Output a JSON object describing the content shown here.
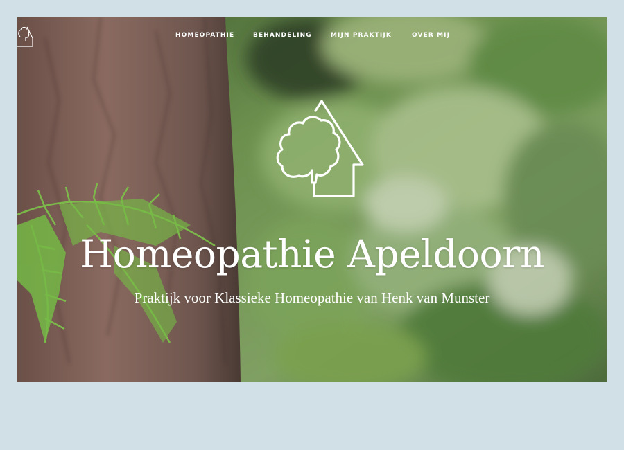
{
  "nav": {
    "items": [
      {
        "label": "HOMEOPATHIE"
      },
      {
        "label": "BEHANDELING"
      },
      {
        "label": "MIJN PRAKTIJK"
      },
      {
        "label": "OVER MIJ"
      }
    ]
  },
  "hero": {
    "title": "Homeopathie Apeldoorn",
    "subtitle": "Praktijk voor Klassieke Homeopathie van Henk van Munster",
    "logo_icon": "tree-house-icon",
    "background": "forest-tree-trunk-fern-photo"
  },
  "colors": {
    "page_background": "#d1dfe6",
    "text": "#ffffff",
    "trunk": "#7a5a50",
    "foliage": "#6f9a52",
    "fern": "#7cc04a"
  }
}
